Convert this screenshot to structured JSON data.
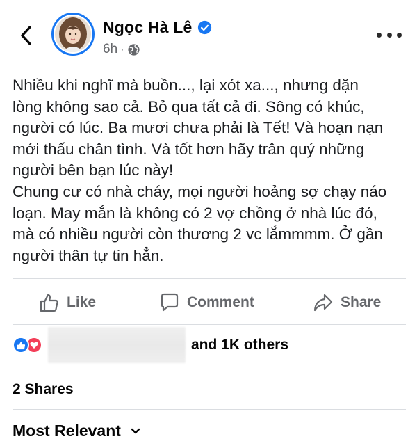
{
  "author": {
    "name": "Ngọc Hà Lê",
    "time": "6h",
    "separator": "·",
    "verified": true,
    "avatar": "profile-photo"
  },
  "post": {
    "lines": [
      "Nhiều khi nghĩ mà buồn..., lại xót xa..., nhưng dặn",
      "lòng không sao cả. Bỏ qua tất cả đi. Sông có khúc,",
      "người có lúc. Ba mươi chưa phải là Tết! Và hoạn nạn",
      "mới thấu chân tình. Và tốt hơn hãy trân quý những",
      "người bên bạn lúc này!",
      "Chung cư có nhà cháy, mọi người hoảng sợ chạy náo",
      "loạn. May mắn là không có 2 vợ chồng ở nhà lúc đó,",
      "mà có nhiều người còn thương 2 vc lắmmmm. Ở gần",
      "người thân tự tin hẳn."
    ]
  },
  "actions": {
    "like": "Like",
    "comment": "Comment",
    "share": "Share"
  },
  "reactions": {
    "icons": [
      "like-reaction-icon",
      "love-reaction-icon"
    ],
    "others": "and 1K others"
  },
  "shares": "2 Shares",
  "comments_filter": "Most Relevant",
  "colors": {
    "accent": "#1877f2",
    "love": "#f33e58",
    "secondary_text": "#65676b",
    "divider": "#dadde1"
  }
}
